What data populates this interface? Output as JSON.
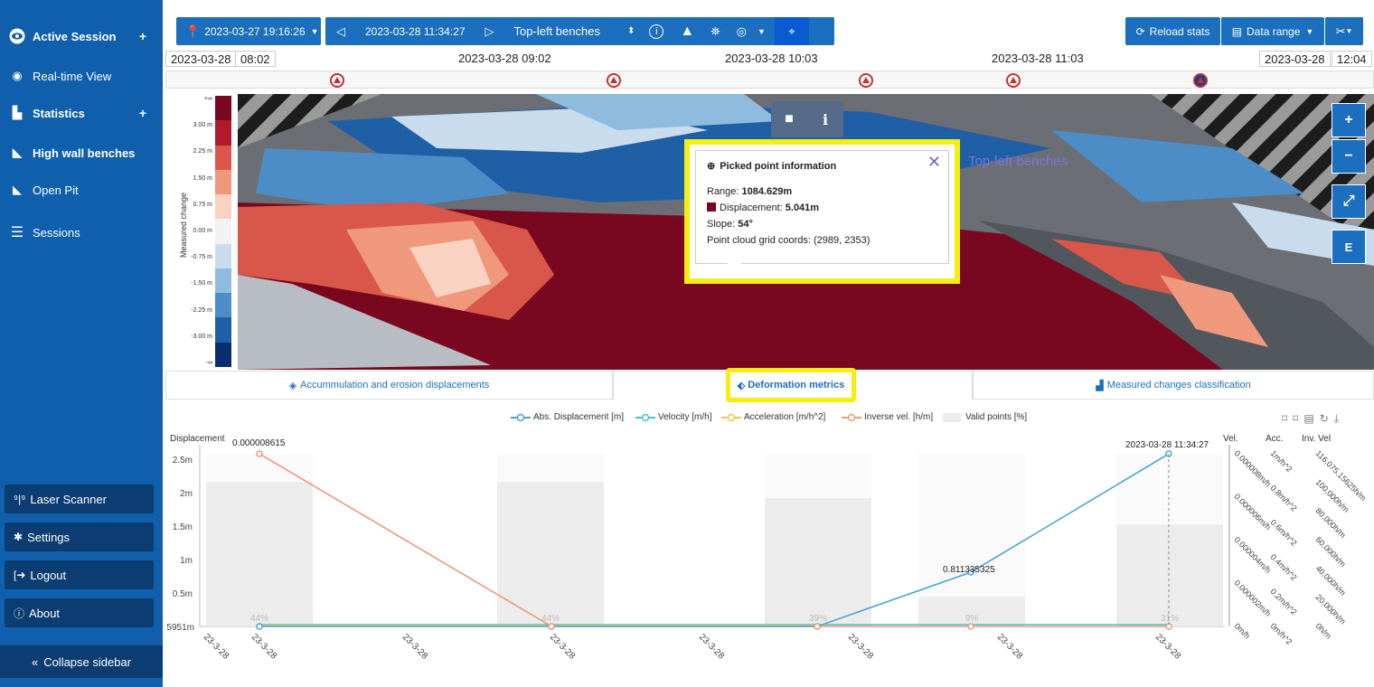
{
  "sidebar": {
    "active_session": "Active Session",
    "realtime": "Real-time View",
    "statistics": "Statistics",
    "high_wall": "High wall benches",
    "open_pit": "Open Pit",
    "sessions": "Sessions",
    "laser": "Laser Scanner",
    "settings": "Settings",
    "logout": "Logout",
    "about": "About",
    "collapse": "Collapse sidebar"
  },
  "toolbar": {
    "start_date": "2023-03-27 19:16:26",
    "end_date": "2023-03-28 11:34:27",
    "region": "Top-left benches",
    "reload": "Reload stats",
    "data_range": "Data range"
  },
  "timeline": {
    "left_date": "2023-03-28",
    "left_time": "08:02",
    "mark1": "2023-03-28 09:02",
    "mark2": "2023-03-28 10:03",
    "mark3": "2023-03-28 11:03",
    "right_date": "2023-03-28",
    "right_time": "12:04"
  },
  "legend": {
    "title": "Measured change",
    "ticks": [
      "+∞",
      "3.00 m",
      "2.25 m",
      "1.50 m",
      "0.75 m",
      "0.00 m",
      "-0.75 m",
      "-1.50 m",
      "-2.25 m",
      "-3.00 m",
      "-∞"
    ],
    "colors": [
      "#7a0720",
      "#b3192e",
      "#d9574a",
      "#f0987c",
      "#fad2c2",
      "#f2f2f2",
      "#c9dcee",
      "#8fbbdf",
      "#4d8dc7",
      "#1e5fa6",
      "#0b2f6e"
    ]
  },
  "map": {
    "region_label": "Top-left benches",
    "compass": "E"
  },
  "popup": {
    "title": "Picked point information",
    "range_label": "Range: ",
    "range_value": "1084.629m",
    "disp_label": "Displacement: ",
    "disp_value": "5.041m",
    "slope_label": "Slope: ",
    "slope_value": "54°",
    "grid": "Point cloud grid coords: (2989, 2353)"
  },
  "tabs": {
    "t1": "Accummulation and erosion displacements",
    "t2": "Deformation metrics",
    "t3": "Measured changes classification"
  },
  "chart_data": {
    "type": "line",
    "legend": [
      "Abs. Displacement [m]",
      "Velocity [m/h]",
      "Acceleration [m/h^2]",
      "Inverse vel. [h/m]",
      "Valid points [%]"
    ],
    "ylabel": "Displacement",
    "y_ticks": [
      "2.5m",
      "2m",
      "1.5m",
      "1m",
      "0.5m"
    ],
    "y_bottom_label": "5951m",
    "x_ticks": [
      "23-3-28",
      "23-3-28",
      "23-3-28",
      "23-3-28",
      "23-3-28",
      "23-3-28",
      "23-3-28",
      "23-3-28"
    ],
    "right_axis_headers": [
      "Vel.",
      "Acc.",
      "Inv. Vel"
    ],
    "vel_ticks": [
      "0.000008m/h",
      "0.000006m/h",
      "0.000004m/h",
      "0.000002m/h",
      "0m/h"
    ],
    "acc_ticks": [
      "1m/h^2",
      "0.8m/h^2",
      "0.6m/h^2",
      "0.4m/h^2",
      "0.2m/h^2",
      "0m/h^2"
    ],
    "inv_ticks": [
      "116,075.15625h/m",
      "100,000h/m",
      "80,000h/m",
      "60,000h/m",
      "40,000h/m",
      "20,000h/m",
      "0h/m"
    ],
    "annotations": {
      "first_point": "0.000008615",
      "mid_point": "0.811335325",
      "last_time": "2023-03-28 11:34:27"
    },
    "valid_points_pct": [
      44,
      44,
      39,
      9,
      31
    ],
    "displacement": [
      0.0,
      0.0,
      0.0,
      0.81,
      2.58
    ],
    "inverse_vel": [
      2.58,
      0.0,
      0.0,
      0.0,
      0.0
    ],
    "colors": {
      "displacement": "#4aa3d8",
      "velocity": "#48c2c8",
      "acceleration": "#f2c54a",
      "inverse_vel": "#f2977a",
      "valid": "#ececec"
    }
  }
}
